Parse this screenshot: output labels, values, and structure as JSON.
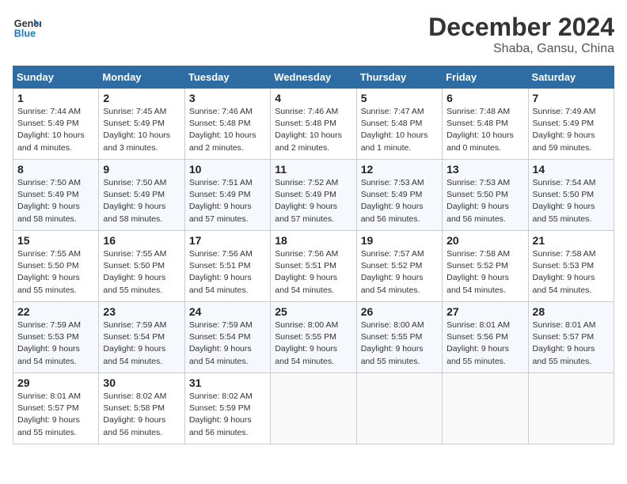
{
  "header": {
    "logo_line1": "General",
    "logo_line2": "Blue",
    "month_year": "December 2024",
    "location": "Shaba, Gansu, China"
  },
  "weekdays": [
    "Sunday",
    "Monday",
    "Tuesday",
    "Wednesday",
    "Thursday",
    "Friday",
    "Saturday"
  ],
  "weeks": [
    [
      {
        "day": "1",
        "sunrise": "7:44 AM",
        "sunset": "5:49 PM",
        "daylight": "10 hours and 4 minutes."
      },
      {
        "day": "2",
        "sunrise": "7:45 AM",
        "sunset": "5:49 PM",
        "daylight": "10 hours and 3 minutes."
      },
      {
        "day": "3",
        "sunrise": "7:46 AM",
        "sunset": "5:48 PM",
        "daylight": "10 hours and 2 minutes."
      },
      {
        "day": "4",
        "sunrise": "7:46 AM",
        "sunset": "5:48 PM",
        "daylight": "10 hours and 2 minutes."
      },
      {
        "day": "5",
        "sunrise": "7:47 AM",
        "sunset": "5:48 PM",
        "daylight": "10 hours and 1 minute."
      },
      {
        "day": "6",
        "sunrise": "7:48 AM",
        "sunset": "5:48 PM",
        "daylight": "10 hours and 0 minutes."
      },
      {
        "day": "7",
        "sunrise": "7:49 AM",
        "sunset": "5:49 PM",
        "daylight": "9 hours and 59 minutes."
      }
    ],
    [
      {
        "day": "8",
        "sunrise": "7:50 AM",
        "sunset": "5:49 PM",
        "daylight": "9 hours and 58 minutes."
      },
      {
        "day": "9",
        "sunrise": "7:50 AM",
        "sunset": "5:49 PM",
        "daylight": "9 hours and 58 minutes."
      },
      {
        "day": "10",
        "sunrise": "7:51 AM",
        "sunset": "5:49 PM",
        "daylight": "9 hours and 57 minutes."
      },
      {
        "day": "11",
        "sunrise": "7:52 AM",
        "sunset": "5:49 PM",
        "daylight": "9 hours and 57 minutes."
      },
      {
        "day": "12",
        "sunrise": "7:53 AM",
        "sunset": "5:49 PM",
        "daylight": "9 hours and 56 minutes."
      },
      {
        "day": "13",
        "sunrise": "7:53 AM",
        "sunset": "5:50 PM",
        "daylight": "9 hours and 56 minutes."
      },
      {
        "day": "14",
        "sunrise": "7:54 AM",
        "sunset": "5:50 PM",
        "daylight": "9 hours and 55 minutes."
      }
    ],
    [
      {
        "day": "15",
        "sunrise": "7:55 AM",
        "sunset": "5:50 PM",
        "daylight": "9 hours and 55 minutes."
      },
      {
        "day": "16",
        "sunrise": "7:55 AM",
        "sunset": "5:50 PM",
        "daylight": "9 hours and 55 minutes."
      },
      {
        "day": "17",
        "sunrise": "7:56 AM",
        "sunset": "5:51 PM",
        "daylight": "9 hours and 54 minutes."
      },
      {
        "day": "18",
        "sunrise": "7:56 AM",
        "sunset": "5:51 PM",
        "daylight": "9 hours and 54 minutes."
      },
      {
        "day": "19",
        "sunrise": "7:57 AM",
        "sunset": "5:52 PM",
        "daylight": "9 hours and 54 minutes."
      },
      {
        "day": "20",
        "sunrise": "7:58 AM",
        "sunset": "5:52 PM",
        "daylight": "9 hours and 54 minutes."
      },
      {
        "day": "21",
        "sunrise": "7:58 AM",
        "sunset": "5:53 PM",
        "daylight": "9 hours and 54 minutes."
      }
    ],
    [
      {
        "day": "22",
        "sunrise": "7:59 AM",
        "sunset": "5:53 PM",
        "daylight": "9 hours and 54 minutes."
      },
      {
        "day": "23",
        "sunrise": "7:59 AM",
        "sunset": "5:54 PM",
        "daylight": "9 hours and 54 minutes."
      },
      {
        "day": "24",
        "sunrise": "7:59 AM",
        "sunset": "5:54 PM",
        "daylight": "9 hours and 54 minutes."
      },
      {
        "day": "25",
        "sunrise": "8:00 AM",
        "sunset": "5:55 PM",
        "daylight": "9 hours and 54 minutes."
      },
      {
        "day": "26",
        "sunrise": "8:00 AM",
        "sunset": "5:55 PM",
        "daylight": "9 hours and 55 minutes."
      },
      {
        "day": "27",
        "sunrise": "8:01 AM",
        "sunset": "5:56 PM",
        "daylight": "9 hours and 55 minutes."
      },
      {
        "day": "28",
        "sunrise": "8:01 AM",
        "sunset": "5:57 PM",
        "daylight": "9 hours and 55 minutes."
      }
    ],
    [
      {
        "day": "29",
        "sunrise": "8:01 AM",
        "sunset": "5:57 PM",
        "daylight": "9 hours and 55 minutes."
      },
      {
        "day": "30",
        "sunrise": "8:02 AM",
        "sunset": "5:58 PM",
        "daylight": "9 hours and 56 minutes."
      },
      {
        "day": "31",
        "sunrise": "8:02 AM",
        "sunset": "5:59 PM",
        "daylight": "9 hours and 56 minutes."
      },
      null,
      null,
      null,
      null
    ]
  ]
}
